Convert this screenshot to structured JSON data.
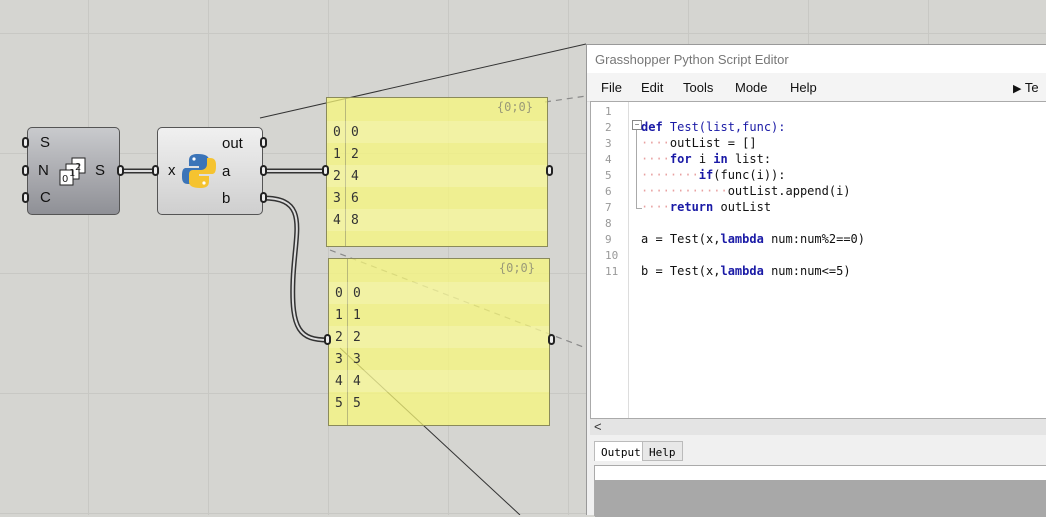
{
  "series_component": {
    "inputs": [
      "S",
      "N",
      "C"
    ],
    "output": "S"
  },
  "python_component": {
    "input": "x",
    "outputs": [
      "out",
      "a",
      "b"
    ]
  },
  "panel_a": {
    "path": "{0;0}",
    "rows": [
      {
        "i": "0",
        "v": "0"
      },
      {
        "i": "1",
        "v": "2"
      },
      {
        "i": "2",
        "v": "4"
      },
      {
        "i": "3",
        "v": "6"
      },
      {
        "i": "4",
        "v": "8"
      }
    ]
  },
  "panel_b": {
    "path": "{0;0}",
    "rows": [
      {
        "i": "0",
        "v": "0"
      },
      {
        "i": "1",
        "v": "1"
      },
      {
        "i": "2",
        "v": "2"
      },
      {
        "i": "3",
        "v": "3"
      },
      {
        "i": "4",
        "v": "4"
      },
      {
        "i": "5",
        "v": "5"
      }
    ]
  },
  "editor": {
    "title": "Grasshopper Python Script Editor",
    "menu": [
      "File",
      "Edit",
      "Tools",
      "Mode",
      "Help"
    ],
    "test_button": "Te",
    "line_numbers": [
      "1",
      "2",
      "3",
      "4",
      "5",
      "6",
      "7",
      "8",
      "9",
      "10",
      "11"
    ],
    "code": {
      "l2_def": "def",
      "l2_rest": " Test(list,func):",
      "l3": "outList = []",
      "l4_kw": "for",
      "l4_mid": " i ",
      "l4_kw2": "in",
      "l4_rest": " list:",
      "l5_kw": "if",
      "l5_rest": "(func(i)):",
      "l6": "outList.append(i)",
      "l7_kw": "return",
      "l7_rest": " outList",
      "l9_pre": "a = Test(x,",
      "l9_kw": "lambda",
      "l9_rest": " num:num%2==0)",
      "l11_pre": "b = Test(x,",
      "l11_kw": "lambda",
      "l11_rest": " num:num<=5)"
    },
    "scroll_left": "<",
    "tabs": [
      "Output",
      "Help"
    ]
  }
}
